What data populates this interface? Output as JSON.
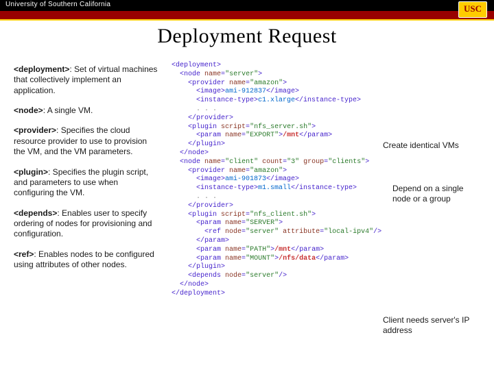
{
  "header": {
    "org": "University of Southern California",
    "logo": "USC"
  },
  "slide": {
    "title": "Deployment Request"
  },
  "definitions": [
    {
      "tag": "<deployment>",
      "text": ": Set of virtual machines that collectively implement an application."
    },
    {
      "tag": "<node>",
      "text": ": A single VM."
    },
    {
      "tag": "<provider>",
      "text": ": Specifies the cloud resource provider to use to provision the VM, and the VM parameters."
    },
    {
      "tag": "<plugin>",
      "text": ": Specifies the plugin script, and parameters to use when configuring the VM."
    },
    {
      "tag": "<depends>",
      "text": ": Enables user to specify ordering of nodes for provisioning and configuration."
    },
    {
      "tag": "<ref>",
      "text": ": Enables nodes to be configured using attributes of other nodes."
    }
  ],
  "annotations": {
    "a1": "Create identical VMs",
    "a2": "Depend on a single node or a group",
    "a3": "Client needs server's IP address"
  },
  "code": {
    "lines": [
      [
        [
          "t",
          "<deployment>"
        ]
      ],
      [
        [
          "ws",
          "  "
        ],
        [
          "t",
          "<node "
        ],
        [
          "a",
          "name"
        ],
        [
          "t",
          "="
        ],
        [
          "v",
          "\"server\""
        ],
        [
          "t",
          ">"
        ]
      ],
      [
        [
          "ws",
          "    "
        ],
        [
          "t",
          "<provider "
        ],
        [
          "a",
          "name"
        ],
        [
          "t",
          "="
        ],
        [
          "v",
          "\"amazon\""
        ],
        [
          "t",
          ">"
        ]
      ],
      [
        [
          "ws",
          "      "
        ],
        [
          "t",
          "<image>"
        ],
        [
          "n",
          "ami-912837"
        ],
        [
          "t",
          "</image>"
        ]
      ],
      [
        [
          "ws",
          "      "
        ],
        [
          "t",
          "<instance-type>"
        ],
        [
          "n",
          "c1.xlarge"
        ],
        [
          "t",
          "</instance-type>"
        ]
      ],
      [
        [
          "ws",
          "      "
        ],
        [
          "d",
          ". . ."
        ]
      ],
      [
        [
          "ws",
          "    "
        ],
        [
          "t",
          "</provider>"
        ]
      ],
      [
        [
          "ws",
          "    "
        ],
        [
          "t",
          "<plugin "
        ],
        [
          "a",
          "script"
        ],
        [
          "t",
          "="
        ],
        [
          "v",
          "\"nfs_server.sh\""
        ],
        [
          "t",
          ">"
        ]
      ],
      [
        [
          "ws",
          "      "
        ],
        [
          "t",
          "<param "
        ],
        [
          "a",
          "name"
        ],
        [
          "t",
          "="
        ],
        [
          "v",
          "\"EXPORT\""
        ],
        [
          "t",
          ">"
        ],
        [
          "r",
          "/mnt"
        ],
        [
          "t",
          "</param>"
        ]
      ],
      [
        [
          "ws",
          "    "
        ],
        [
          "t",
          "</plugin>"
        ]
      ],
      [
        [
          "ws",
          "  "
        ],
        [
          "t",
          "</node>"
        ]
      ],
      [
        [
          "ws",
          "  "
        ],
        [
          "t",
          "<node "
        ],
        [
          "a",
          "name"
        ],
        [
          "t",
          "="
        ],
        [
          "v",
          "\"client\""
        ],
        [
          "t",
          " "
        ],
        [
          "a",
          "count"
        ],
        [
          "t",
          "="
        ],
        [
          "v",
          "\"3\""
        ],
        [
          "t",
          " "
        ],
        [
          "a",
          "group"
        ],
        [
          "t",
          "="
        ],
        [
          "v",
          "\"clients\""
        ],
        [
          "t",
          ">"
        ]
      ],
      [
        [
          "ws",
          "    "
        ],
        [
          "t",
          "<provider "
        ],
        [
          "a",
          "name"
        ],
        [
          "t",
          "="
        ],
        [
          "v",
          "\"amazon\""
        ],
        [
          "t",
          ">"
        ]
      ],
      [
        [
          "ws",
          "      "
        ],
        [
          "t",
          "<image>"
        ],
        [
          "n",
          "ami-901873"
        ],
        [
          "t",
          "</image>"
        ]
      ],
      [
        [
          "ws",
          "      "
        ],
        [
          "t",
          "<instance-type>"
        ],
        [
          "n",
          "m1.small"
        ],
        [
          "t",
          "</instance-type>"
        ]
      ],
      [
        [
          "ws",
          "      "
        ],
        [
          "d",
          ". . ."
        ]
      ],
      [
        [
          "ws",
          "    "
        ],
        [
          "t",
          "</provider>"
        ]
      ],
      [
        [
          "ws",
          "    "
        ],
        [
          "t",
          "<plugin "
        ],
        [
          "a",
          "script"
        ],
        [
          "t",
          "="
        ],
        [
          "v",
          "\"nfs_client.sh\""
        ],
        [
          "t",
          ">"
        ]
      ],
      [
        [
          "ws",
          "      "
        ],
        [
          "t",
          "<param "
        ],
        [
          "a",
          "name"
        ],
        [
          "t",
          "="
        ],
        [
          "v",
          "\"SERVER\""
        ],
        [
          "t",
          ">"
        ]
      ],
      [
        [
          "ws",
          "        "
        ],
        [
          "t",
          "<ref "
        ],
        [
          "a",
          "node"
        ],
        [
          "t",
          "="
        ],
        [
          "v",
          "\"server\""
        ],
        [
          "t",
          " "
        ],
        [
          "a",
          "attribute"
        ],
        [
          "t",
          "="
        ],
        [
          "v",
          "\"local-ipv4\""
        ],
        [
          "t",
          "/>"
        ]
      ],
      [
        [
          "ws",
          "      "
        ],
        [
          "t",
          "</param>"
        ]
      ],
      [
        [
          "ws",
          "      "
        ],
        [
          "t",
          "<param "
        ],
        [
          "a",
          "name"
        ],
        [
          "t",
          "="
        ],
        [
          "v",
          "\"PATH\""
        ],
        [
          "t",
          ">"
        ],
        [
          "r",
          "/mnt"
        ],
        [
          "t",
          "</param>"
        ]
      ],
      [
        [
          "ws",
          "      "
        ],
        [
          "t",
          "<param "
        ],
        [
          "a",
          "name"
        ],
        [
          "t",
          "="
        ],
        [
          "v",
          "\"MOUNT\""
        ],
        [
          "t",
          ">"
        ],
        [
          "r",
          "/nfs/data"
        ],
        [
          "t",
          "</param>"
        ]
      ],
      [
        [
          "ws",
          "    "
        ],
        [
          "t",
          "</plugin>"
        ]
      ],
      [
        [
          "ws",
          "    "
        ],
        [
          "t",
          "<depends "
        ],
        [
          "a",
          "node"
        ],
        [
          "t",
          "="
        ],
        [
          "v",
          "\"server\""
        ],
        [
          "t",
          "/>"
        ]
      ],
      [
        [
          "ws",
          "  "
        ],
        [
          "t",
          "</node>"
        ]
      ],
      [
        [
          "t",
          "</deployment>"
        ]
      ]
    ]
  }
}
